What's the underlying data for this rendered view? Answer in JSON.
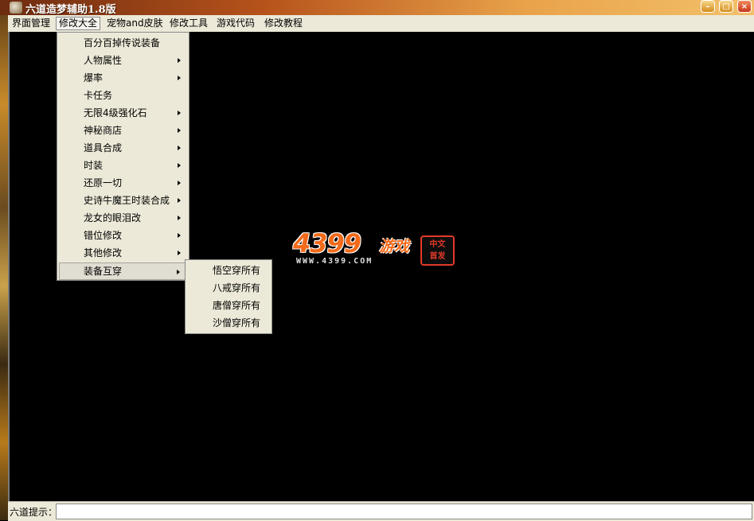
{
  "window": {
    "title": "六道造梦辅助1.8版",
    "minimize_label": "–",
    "maximize_label": "□",
    "close_label": "×"
  },
  "menubar": {
    "items": [
      "界面管理",
      "修改大全",
      "宠物and皮肤",
      "修改工具",
      "游戏代码",
      "修改教程"
    ],
    "active": "修改大全"
  },
  "dropdown": {
    "items": [
      {
        "label": "百分百掉传说装备",
        "submenu": false
      },
      {
        "label": "人物属性",
        "submenu": true
      },
      {
        "label": "爆率",
        "submenu": true
      },
      {
        "label": "卡任务",
        "submenu": false
      },
      {
        "label": "无限4级强化石",
        "submenu": true
      },
      {
        "label": "神秘商店",
        "submenu": true
      },
      {
        "label": "道具合成",
        "submenu": true
      },
      {
        "label": "时装",
        "submenu": true
      },
      {
        "label": "还原一切",
        "submenu": true
      },
      {
        "label": "史诗牛魔王时装合成",
        "submenu": true
      },
      {
        "label": "龙女的眼泪改",
        "submenu": true
      },
      {
        "label": "错位修改",
        "submenu": true
      },
      {
        "label": "其他修改",
        "submenu": true
      },
      {
        "label": "装备互穿",
        "submenu": true
      }
    ],
    "highlighted": "装备互穿"
  },
  "submenu": {
    "items": [
      "悟空穿所有",
      "八戒穿所有",
      "唐僧穿所有",
      "沙僧穿所有"
    ]
  },
  "logo": {
    "number": "4399",
    "chinese": "游戏",
    "url": "WWW.4399.COM",
    "seal_line1": "中文",
    "seal_line2": "首发",
    "accent_color": "#f36a1a"
  },
  "statusbar": {
    "label": "六道提示：",
    "value": ""
  }
}
